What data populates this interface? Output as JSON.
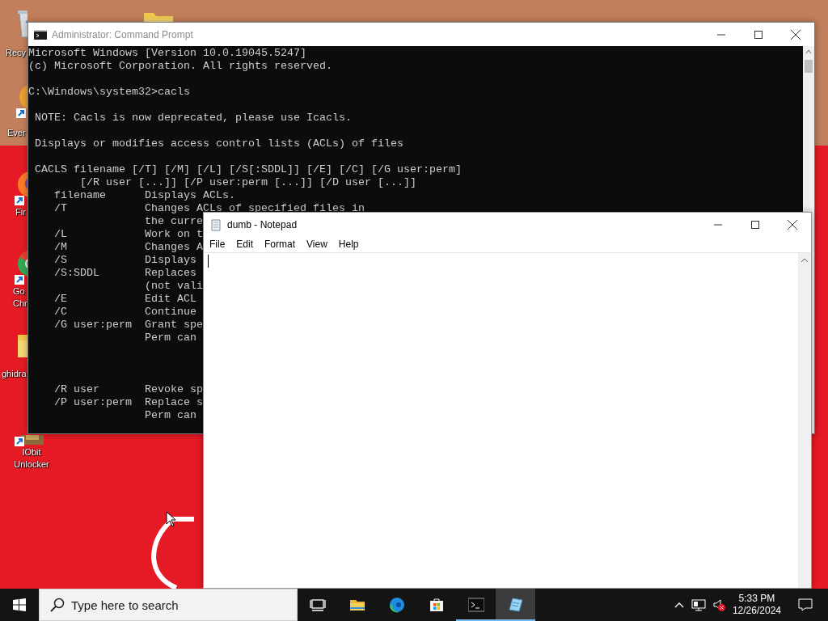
{
  "desktop": {
    "icons": [
      {
        "kind": "recycle-bin",
        "label_lines": [
          "Recy"
        ]
      },
      {
        "kind": "folder"
      },
      {
        "kind": "evernote",
        "label_lines": [
          "Ever"
        ]
      },
      {
        "kind": "firefox",
        "label_lines": [
          "Fir"
        ]
      },
      {
        "kind": "chrome",
        "label_lines": [
          "Go",
          "Chr"
        ]
      },
      {
        "kind": "folder",
        "label_lines": [
          "ghidra"
        ]
      },
      {
        "kind": "iobit",
        "label_lines": [
          "IObit",
          "Unlocker"
        ]
      }
    ]
  },
  "windows": [
    {
      "kind": "console",
      "title": "Administrator: Command Prompt",
      "active": false,
      "console": {
        "header": [
          "Microsoft Windows [Version 10.0.19045.5247]",
          "(c) Microsoft Corporation. All rights reserved."
        ],
        "prompt": "C:\\Windows\\system32>cacls",
        "note": "NOTE: Cacls is now deprecated, please use Icacls.",
        "summary": "Displays or modifies access control lists (ACLs) of files",
        "usage": [
          "CACLS filename [/T] [/M] [/L] [/S[:SDDL]] [/E] [/C] [/G user:perm]",
          "[/R user [...]] [/P user:perm [...]] [/D user [...]]"
        ],
        "options": [
          {
            "kind": "switch",
            "switch": "filename",
            "description": "Displays ACLs."
          },
          {
            "kind": "switch",
            "switch": "/T",
            "description": "Changes ACLs of specified files in"
          },
          {
            "kind": "continued",
            "description": "the curre"
          },
          {
            "kind": "switch",
            "switch": "/L",
            "description": "Work on t"
          },
          {
            "kind": "switch",
            "switch": "/M",
            "description": "Changes A"
          },
          {
            "kind": "switch",
            "switch": "/S",
            "description": "Displays"
          },
          {
            "kind": "switch",
            "switch": "/S:SDDL",
            "description": "Replaces"
          },
          {
            "kind": "continued",
            "description": "(not vali"
          },
          {
            "kind": "switch",
            "switch": "/E",
            "description": "Edit ACL"
          },
          {
            "kind": "switch",
            "switch": "/C",
            "description": "Continue"
          },
          {
            "kind": "switch",
            "switch": "/G user:perm",
            "description": "Grant spe"
          },
          {
            "kind": "continued",
            "description": "Perm can"
          },
          {
            "kind": "hidden"
          },
          {
            "kind": "hidden"
          },
          {
            "kind": "hidden"
          },
          {
            "kind": "switch",
            "switch": "/R user",
            "description": "Revoke sp"
          },
          {
            "kind": "switch",
            "switch": "/P user:perm",
            "description": "Replace s"
          },
          {
            "kind": "continued",
            "description": "Perm can"
          }
        ]
      }
    },
    {
      "kind": "editor",
      "title": "dumb - Notepad",
      "active": true,
      "menu": [
        "File",
        "Edit",
        "Format",
        "View",
        "Help"
      ]
    }
  ],
  "taskbar": {
    "search": {
      "placeholder": "Type here to search"
    },
    "apps": [
      {
        "kind": "task-view",
        "running": false,
        "selected": false
      },
      {
        "kind": "explorer",
        "running": false,
        "selected": false
      },
      {
        "kind": "edge",
        "running": false,
        "selected": false
      },
      {
        "kind": "store",
        "running": false,
        "selected": false
      },
      {
        "kind": "terminal",
        "running": true,
        "selected": false
      },
      {
        "kind": "notepad",
        "running": true,
        "selected": true
      }
    ],
    "tray": {
      "volume_muted": true
    },
    "clock": {
      "time": "5:33 PM",
      "date": "12/26/2024"
    }
  }
}
